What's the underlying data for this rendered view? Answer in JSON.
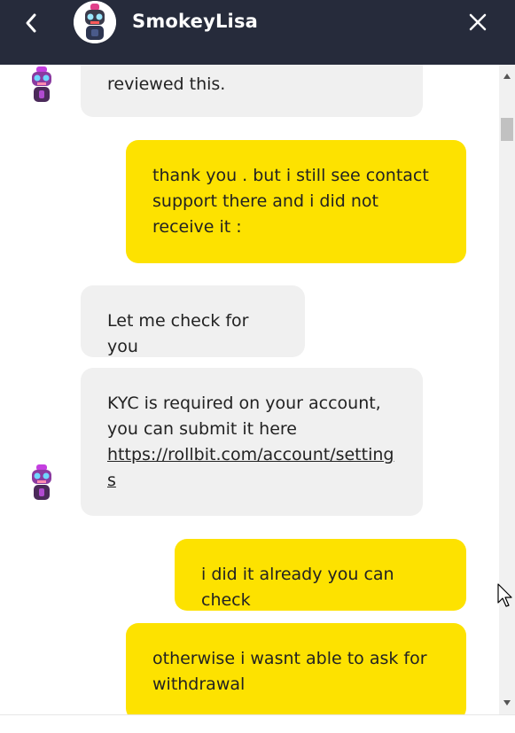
{
  "header": {
    "title": "SmokeyLisa",
    "back_icon": "chevron-left-icon",
    "close_icon": "close-icon",
    "background": "#262b3b"
  },
  "colors": {
    "agent_bubble": "#f0f0f0",
    "user_bubble": "#fde200",
    "text": "#222222"
  },
  "messages": [
    {
      "sender": "agent",
      "text": "reviewed this.",
      "partial": true
    },
    {
      "sender": "user",
      "text": "thank you . but i still see contact support there and i did not receive it :"
    },
    {
      "sender": "agent",
      "text": "Let me check for you"
    },
    {
      "sender": "agent",
      "text": "KYC is required on your account, you can submit it here",
      "link": "https://rollbit.com/account/settings"
    },
    {
      "sender": "user",
      "text": "i did it already you can check"
    },
    {
      "sender": "user",
      "text": "otherwise i wasnt able to ask for withdrawal"
    }
  ]
}
